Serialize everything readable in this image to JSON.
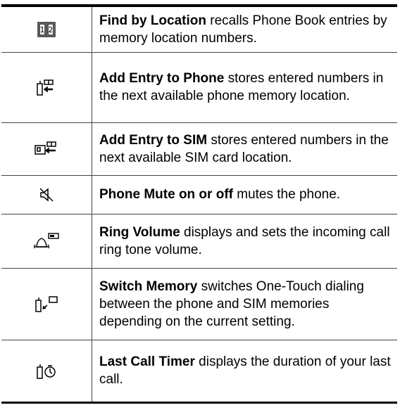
{
  "rows": [
    {
      "icon": "phone-book-icon",
      "term": "Find by Location",
      "desc": " recalls Phone Book entries by memory location numbers."
    },
    {
      "icon": "add-to-phone-icon",
      "term": "Add Entry to Phone",
      "desc": " stores entered numbers in the next available phone memory location."
    },
    {
      "icon": "add-to-sim-icon",
      "term": "Add Entry to SIM",
      "desc": " stores entered numbers in the next available SIM card location."
    },
    {
      "icon": "mute-icon",
      "term": "Phone Mute on or off",
      "desc": " mutes the phone."
    },
    {
      "icon": "ring-volume-icon",
      "term": "Ring Volume",
      "desc": " displays and sets the incoming call ring tone volume."
    },
    {
      "icon": "switch-memory-icon",
      "term": "Switch Memory",
      "desc": " switches One-Touch dialing between the phone and SIM memories depending on the current setting."
    },
    {
      "icon": "call-timer-icon",
      "term": "Last Call Timer",
      "desc": " displays the duration of your last call."
    }
  ]
}
